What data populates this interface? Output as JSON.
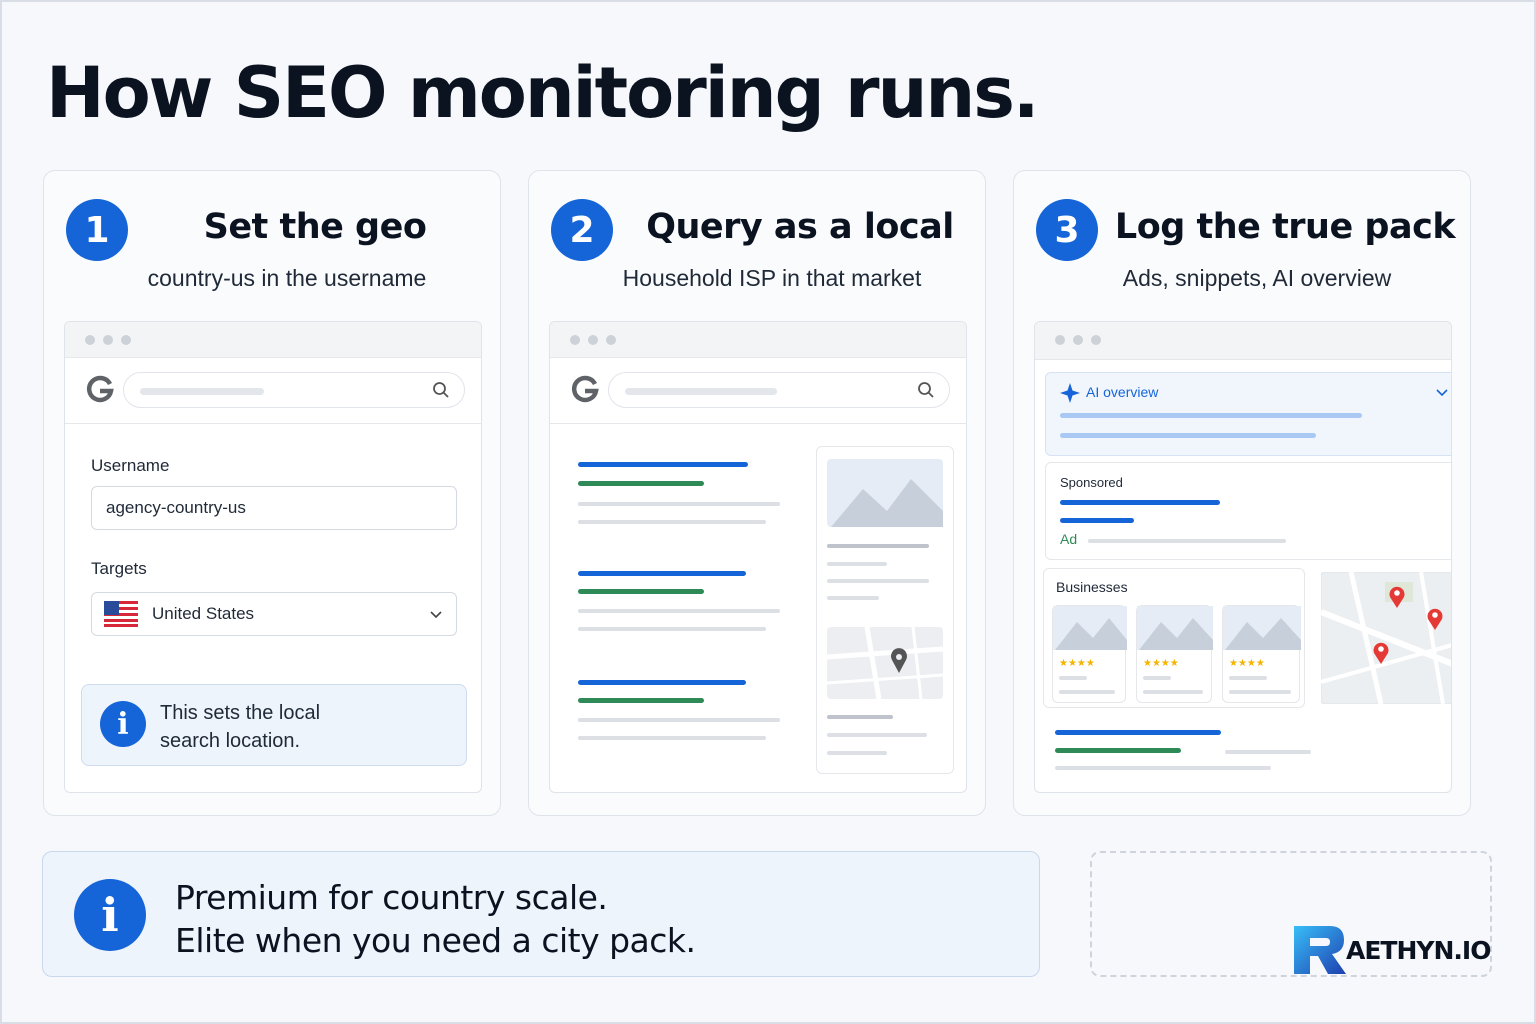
{
  "headline": "How SEO monitoring runs.",
  "steps": [
    {
      "number": "1",
      "title": "Set the geo",
      "subtitle": "country-us in the username"
    },
    {
      "number": "2",
      "title": "Query as a local",
      "subtitle": "Household ISP in that market"
    },
    {
      "number": "3",
      "title": "Log the true pack",
      "subtitle": "Ads, snippets, AI overview"
    }
  ],
  "step1": {
    "username_label": "Username",
    "username_value": "agency-country-us",
    "targets_label": "Targets",
    "targets_value": "United States",
    "info_line1": "This sets the local",
    "info_line2": "search location."
  },
  "step3": {
    "ai_overview_label": "AI overview",
    "sponsored_label": "Sponsored",
    "ad_label": "Ad",
    "businesses_label": "Businesses",
    "rating_stars": "★★★★"
  },
  "bottom": {
    "line1": "Premium for country scale.",
    "line2": "Elite when you need a city pack."
  },
  "brand": {
    "name": "AETHYN.IO"
  },
  "colors": {
    "accent": "#1565d8",
    "green": "#2e8b57",
    "pin": "#e53935",
    "star": "#f4b400"
  }
}
